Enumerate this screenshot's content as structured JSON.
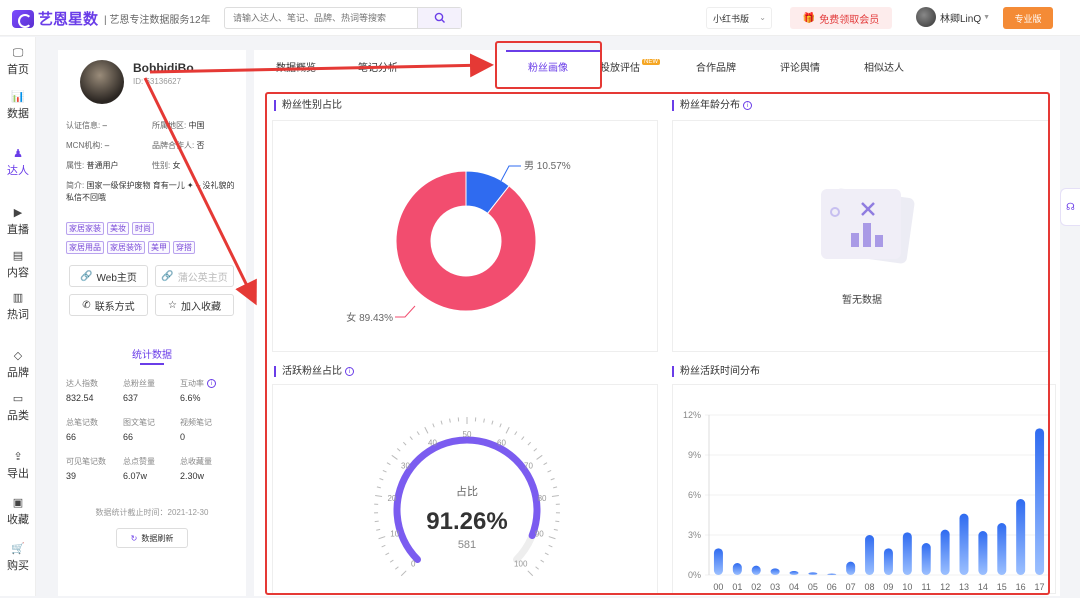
{
  "app": {
    "logo_text": "艺恩星数",
    "slogan": "| 艺恩专注数据服务12年",
    "search_placeholder": "请输入达人、笔记、品牌、热词等搜索",
    "platform": "小红书版",
    "vip_button": "免费领取会员",
    "user_name": "林卿LinQ",
    "pro_badge": "专业版"
  },
  "nav": [
    "首页",
    "数据",
    "达人",
    "直播",
    "内容",
    "热词",
    "品牌",
    "品类",
    "导出",
    "收藏",
    "购买"
  ],
  "profile": {
    "name": "BobbidiBo",
    "id": "ID: 63136627",
    "info": [
      {
        "label": "认证信息:",
        "value": "–"
      },
      {
        "label": "所属地区:",
        "value": "中国"
      },
      {
        "label": "MCN机构:",
        "value": "–"
      },
      {
        "label": "品牌合作人:",
        "value": "否"
      },
      {
        "label": "属性:",
        "value": "普通用户"
      },
      {
        "label": "性别:",
        "value": "女"
      }
    ],
    "intro_label": "简介:",
    "intro_text": "国家一级保护废物 育有一儿 ✦ – 没礼貌的私信不回哦",
    "tags": [
      "家居家装",
      "美妆",
      "时尚",
      "家居用品",
      "家居装饰",
      "美甲",
      "穿搭"
    ],
    "buttons": {
      "web": "Web主页",
      "wechat": "蒲公英主页",
      "contact": "联系方式",
      "favorite": "加入收藏"
    },
    "stats_title": "统计数据",
    "stats": [
      {
        "label": "达人指数",
        "value": "832.54"
      },
      {
        "label": "总粉丝量",
        "value": "637"
      },
      {
        "label": "互动率",
        "value": "6.6%"
      },
      {
        "label": "总笔记数",
        "value": "66"
      },
      {
        "label": "图文笔记",
        "value": "66"
      },
      {
        "label": "视频笔记",
        "value": "0"
      },
      {
        "label": "可见笔记数",
        "value": "39"
      },
      {
        "label": "总点赞量",
        "value": "6.07w"
      },
      {
        "label": "总收藏量",
        "value": "2.30w"
      }
    ],
    "refresh_time": "数据统计截止时间：2021-12-30",
    "refresh_button": "数据刷新"
  },
  "tabs": [
    "数据概览",
    "笔记分析",
    "粉丝画像",
    "投放评估",
    "合作品牌",
    "评论舆情",
    "相似达人"
  ],
  "new_badge": "NEW",
  "cards": {
    "gender_title": "粉丝性别占比",
    "age_title": "粉丝年龄分布",
    "active_title": "活跃粉丝占比",
    "time_title": "粉丝活跃时间分布",
    "no_data": "暂无数据"
  },
  "chart_data": [
    {
      "type": "pie",
      "title": "粉丝性别占比",
      "labels": [
        "男",
        "女"
      ],
      "values": [
        10.57,
        89.43
      ],
      "value_labels": [
        "男 10.57%",
        "女 89.43%"
      ],
      "colors": [
        "#2f6bf0",
        "#f24d6f"
      ]
    },
    {
      "type": "gauge",
      "title": "活跃粉丝占比",
      "center_label": "占比",
      "value": 91.26,
      "value_label": "91.26%",
      "count": "581",
      "ticks": [
        "0",
        "10",
        "20",
        "30",
        "40",
        "50",
        "60",
        "70",
        "80",
        "90",
        "100"
      ],
      "range": [
        0,
        100
      ]
    },
    {
      "type": "bar",
      "title": "粉丝活跃时间分布",
      "categories": [
        "00",
        "01",
        "02",
        "03",
        "04",
        "05",
        "06",
        "07",
        "08",
        "09",
        "10",
        "11",
        "12",
        "13",
        "14",
        "15",
        "16",
        "17"
      ],
      "values": [
        2.0,
        0.9,
        0.7,
        0.5,
        0.3,
        0.2,
        0.1,
        1.0,
        3.0,
        2.0,
        3.2,
        2.4,
        3.4,
        4.6,
        3.3,
        3.9,
        5.7,
        11.0
      ],
      "ylim": [
        0,
        12
      ],
      "yticks": [
        "0%",
        "3%",
        "6%",
        "9%",
        "12%"
      ],
      "color": "#3a7af5"
    }
  ]
}
